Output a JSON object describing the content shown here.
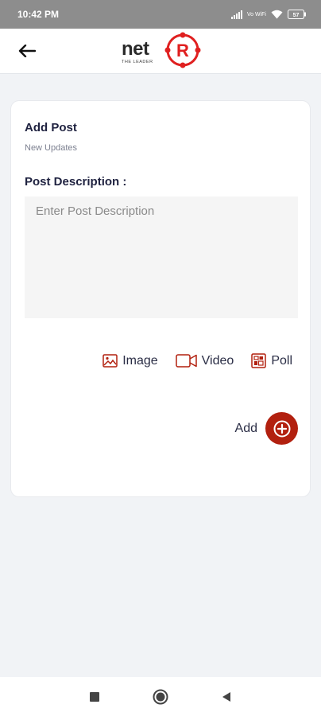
{
  "status_bar": {
    "time": "10:42 PM",
    "network_label": "Vo WiFi",
    "battery_level": "57"
  },
  "app_bar": {
    "logo_text": "net",
    "logo_letter": "R",
    "logo_tagline": "THE LEADER"
  },
  "card": {
    "title": "Add Post",
    "subtitle": "New Updates",
    "description_label": "Post Description :",
    "description_placeholder": "Enter Post Description",
    "description_value": ""
  },
  "attachments": [
    {
      "label": "Image",
      "icon": "image-icon"
    },
    {
      "label": "Video",
      "icon": "video-icon"
    },
    {
      "label": "Poll",
      "icon": "poll-icon"
    }
  ],
  "add_action": {
    "label": "Add"
  },
  "colors": {
    "accent": "#b2200f",
    "logo_red": "#e02020",
    "text_primary": "#1f2240",
    "background": "#f1f3f6"
  }
}
